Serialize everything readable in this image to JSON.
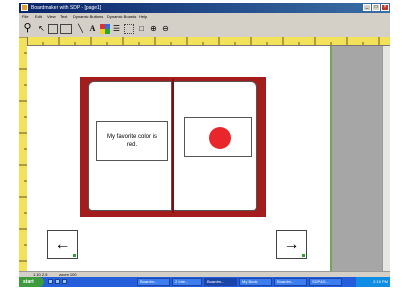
{
  "window": {
    "title": "Boardmaker with SDP - [page1]",
    "controls": [
      "_",
      "□",
      "×"
    ]
  },
  "menu": [
    "File",
    "Edit",
    "View",
    "Text",
    "Dynamic Buttons",
    "Dynamic Boards",
    "Help"
  ],
  "toolbar": {
    "tools": [
      {
        "name": "pointer-tool",
        "glyph": "↖"
      },
      {
        "name": "rectangle-tool",
        "glyph": ""
      },
      {
        "name": "button-tool",
        "glyph": ""
      },
      {
        "name": "line-tool",
        "glyph": "╲"
      },
      {
        "name": "text-tool",
        "glyph": "A"
      },
      {
        "name": "color-tool",
        "glyph": ""
      },
      {
        "name": "line-thickness-tool",
        "glyph": "☰"
      },
      {
        "name": "frame-tool",
        "glyph": ""
      },
      {
        "name": "border-tool",
        "glyph": "□"
      },
      {
        "name": "zoom-in-tool",
        "glyph": "⊕"
      },
      {
        "name": "zoom-out-tool",
        "glyph": "⊖"
      }
    ]
  },
  "ruler": {
    "marks": [
      "1",
      "2",
      "3",
      "4",
      "5",
      "6",
      "7",
      "8",
      "9",
      "10",
      "11"
    ]
  },
  "book": {
    "left_text": "My favorite color is red.",
    "picture_icon": "red-circle-icon",
    "picture_color": "#e8262b"
  },
  "navigation": {
    "prev_icon": "left-arrow-icon",
    "prev_glyph": "←",
    "next_icon": "right-arrow-icon",
    "next_glyph": "→"
  },
  "status": {
    "coords": "1.10 2.5",
    "zoom": "zoom 100"
  },
  "taskbar": {
    "start": "start",
    "tasks": [
      "Boardm...",
      "2 Inte...",
      "Boardm...",
      "My Book",
      "Boardm...",
      "SDP&S..."
    ],
    "clock": "2:15 PM"
  },
  "colors": {
    "book_cover": "#a31d1d",
    "ruler": "#f3e15a",
    "taskbar": "#245edb"
  }
}
